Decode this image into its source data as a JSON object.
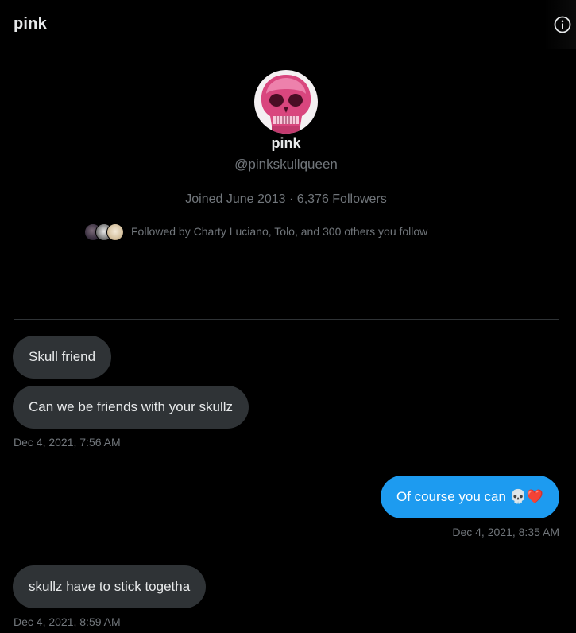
{
  "header": {
    "title": "pink",
    "info_icon": "info-icon"
  },
  "profile": {
    "display_name": "pink",
    "handle": "@pinkskullqueen",
    "meta": "Joined June 2013 · 6,376 Followers",
    "followed_by": "Followed by Charty Luciano, Tolo, and 300 others you follow"
  },
  "messages": [
    {
      "direction": "in",
      "text": "Skull friend"
    },
    {
      "direction": "in",
      "text": "Can we be friends with your skullz",
      "timestamp": "Dec 4, 2021, 7:56 AM"
    },
    {
      "direction": "out",
      "text": "Of course you can 💀❤️",
      "timestamp": "Dec 4, 2021, 8:35 AM"
    },
    {
      "direction": "in",
      "text": "skullz have to stick togetha",
      "timestamp": "Dec 4, 2021, 8:59 AM"
    }
  ],
  "colors": {
    "background": "#000000",
    "incoming_bubble": "#2f3336",
    "outgoing_bubble": "#1d9bf0",
    "secondary_text": "#71767b",
    "avatar_pink": "#d9467e"
  }
}
